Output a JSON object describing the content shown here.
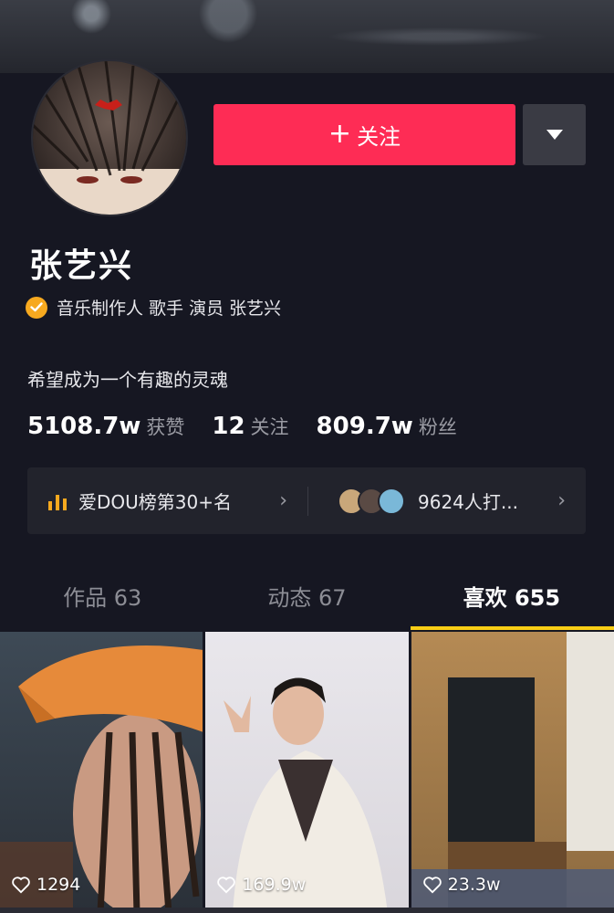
{
  "profile": {
    "name": "张艺兴",
    "verification": "音乐制作人 歌手 演员 张艺兴",
    "bio": "希望成为一个有趣的灵魂"
  },
  "actions": {
    "follow_label": "关注",
    "follow_plus": "+"
  },
  "stats": [
    {
      "value": "5108.7w",
      "label": "获赞"
    },
    {
      "value": "12",
      "label": "关注"
    },
    {
      "value": "809.7w",
      "label": "粉丝"
    }
  ],
  "info_bar": {
    "rank_text": "爱DOU榜第30+名",
    "fans_text": "9624人打..."
  },
  "tabs": [
    {
      "label": "作品 63"
    },
    {
      "label": "动态 67"
    },
    {
      "label": "喜欢 655"
    }
  ],
  "grid": [
    {
      "likes": "1294"
    },
    {
      "likes": "169.9w"
    },
    {
      "likes": "23.3w"
    }
  ],
  "colors": {
    "accent": "#fe2c55",
    "tab_indicator": "#face15",
    "verify_badge": "#f7a91f"
  }
}
